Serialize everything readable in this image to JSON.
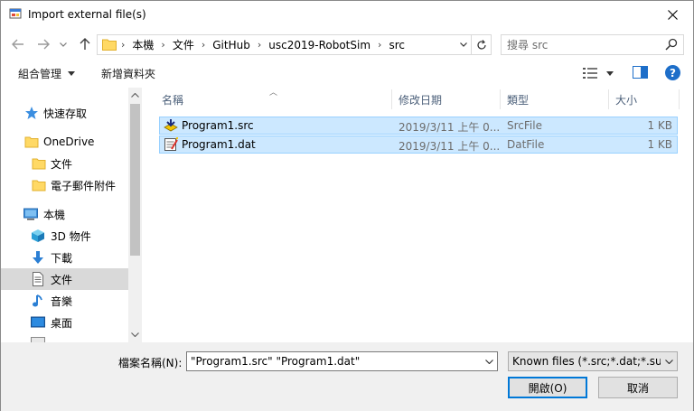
{
  "window": {
    "title": "Import external file(s)"
  },
  "address": {
    "crumbs": [
      "本機",
      "文件",
      "GitHub",
      "usc2019-RobotSim",
      "src"
    ]
  },
  "search": {
    "placeholder": "搜尋 src"
  },
  "toolbar": {
    "organize": "組合管理",
    "new_folder": "新增資料夾"
  },
  "nav": {
    "items": [
      {
        "label": "快速存取",
        "icon": "star-icon"
      },
      {
        "label": "OneDrive",
        "icon": "folder-icon"
      },
      {
        "label": "文件",
        "icon": "folder-icon"
      },
      {
        "label": "電子郵件附件",
        "icon": "folder-icon"
      },
      {
        "label": "本機",
        "icon": "computer-icon"
      },
      {
        "label": "3D 物件",
        "icon": "cube-icon"
      },
      {
        "label": "下載",
        "icon": "download-icon"
      },
      {
        "label": "文件",
        "icon": "document-icon"
      },
      {
        "label": "音樂",
        "icon": "music-icon"
      },
      {
        "label": "桌面",
        "icon": "desktop-icon"
      }
    ]
  },
  "columns": {
    "name": "名稱",
    "date": "修改日期",
    "type": "類型",
    "size": "大小"
  },
  "files": [
    {
      "name": "Program1.src",
      "date": "2019/3/11 上午 0...",
      "type": "SrcFile",
      "size": "1 KB"
    },
    {
      "name": "Program1.dat",
      "date": "2019/3/11 上午 0...",
      "type": "DatFile",
      "size": "1 KB"
    }
  ],
  "bottom": {
    "filename_label": "檔案名稱(N):",
    "filename_value": "\"Program1.src\" \"Program1.dat\"",
    "filter": "Known files (*.src;*.dat;*.sub;*.",
    "open": "開啟(O)",
    "cancel": "取消"
  }
}
